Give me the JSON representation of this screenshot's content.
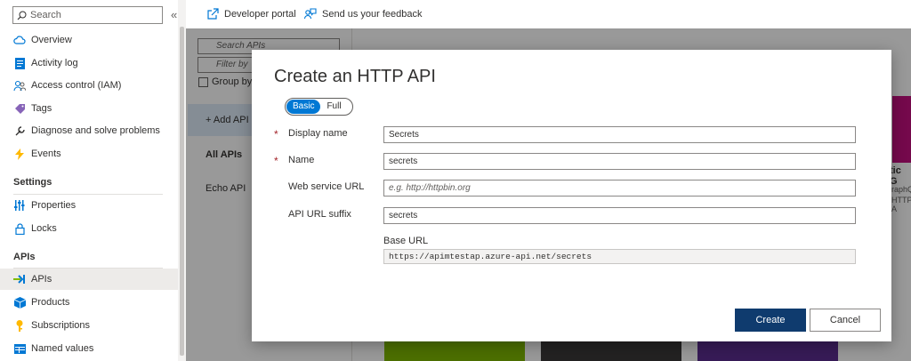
{
  "sidebar": {
    "search_placeholder": "Search",
    "collapse_glyph": "«",
    "items": [
      {
        "label": "Overview",
        "icon": "cloud-icon"
      },
      {
        "label": "Activity log",
        "icon": "activity-log-icon"
      },
      {
        "label": "Access control (IAM)",
        "icon": "people-icon"
      },
      {
        "label": "Tags",
        "icon": "tag-icon"
      },
      {
        "label": "Diagnose and solve problems",
        "icon": "wrench-icon"
      },
      {
        "label": "Events",
        "icon": "bolt-icon"
      }
    ],
    "settings_title": "Settings",
    "settings_items": [
      {
        "label": "Properties",
        "icon": "properties-icon"
      },
      {
        "label": "Locks",
        "icon": "lock-icon"
      }
    ],
    "apis_title": "APIs",
    "apis_items": [
      {
        "label": "APIs",
        "icon": "api-icon",
        "active": true
      },
      {
        "label": "Products",
        "icon": "products-icon"
      },
      {
        "label": "Subscriptions",
        "icon": "key-icon"
      },
      {
        "label": "Named values",
        "icon": "named-values-icon"
      }
    ]
  },
  "topbar": {
    "developer_portal": "Developer portal",
    "feedback": "Send us your feedback"
  },
  "background": {
    "search_placeholder": "Search APIs",
    "filter_placeholder": "Filter by",
    "group_by": "Group by",
    "add_api": "Add API",
    "all_apis": "All APIs",
    "echo_api": "Echo API",
    "tile_title_fragment": "tic G",
    "tile_text_1": "raphQ",
    "tile_text_2": "HTTP A"
  },
  "modal": {
    "title": "Create an HTTP API",
    "toggle": {
      "basic": "Basic",
      "full": "Full",
      "selected": "Basic"
    },
    "fields": {
      "display_name": {
        "label": "Display name",
        "value": "Secrets",
        "required": true
      },
      "name": {
        "label": "Name",
        "value": "secrets",
        "required": true
      },
      "web_service_url": {
        "label": "Web service URL",
        "placeholder": "e.g. http://httpbin.org"
      },
      "api_url_suffix": {
        "label": "API URL suffix",
        "value": "secrets"
      }
    },
    "base_url": {
      "label": "Base URL",
      "value": "https://apimtestap.azure-api.net/secrets"
    },
    "buttons": {
      "create": "Create",
      "cancel": "Cancel"
    }
  },
  "colors": {
    "accent": "#0078d4",
    "primary_button": "#0f3b6e",
    "required": "#a4262c",
    "tile_magenta": "#c4107f",
    "tile_green": "#7fba00",
    "tile_dark": "#3b3a39",
    "tile_purple": "#5c2d91"
  }
}
